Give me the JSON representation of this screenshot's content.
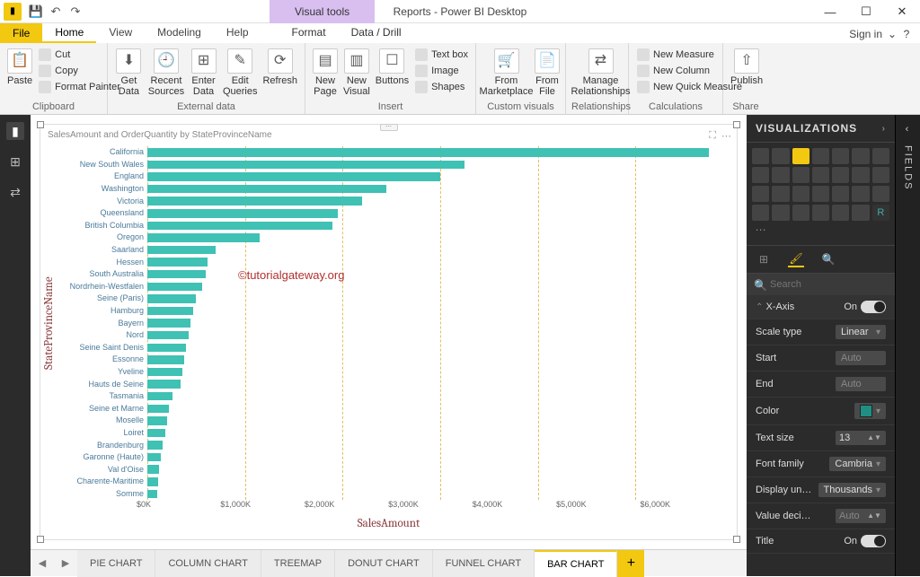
{
  "titlebar": {
    "app_title": "Reports - Power BI Desktop",
    "visual_tools": "Visual tools",
    "app_icon": "⬛"
  },
  "window_controls": {
    "min": "—",
    "max": "☐",
    "close": "✕"
  },
  "menu": {
    "file": "File",
    "home": "Home",
    "view": "View",
    "modeling": "Modeling",
    "help": "Help",
    "format": "Format",
    "datadrill": "Data / Drill",
    "signin": "Sign in"
  },
  "ribbon": {
    "clipboard": {
      "label": "Clipboard",
      "paste": "Paste",
      "cut": "Cut",
      "copy": "Copy",
      "fp": "Format Painter"
    },
    "external": {
      "label": "External data",
      "getdata": "Get Data",
      "recent": "Recent Sources",
      "enter": "Enter Data",
      "edit": "Edit Queries",
      "refresh": "Refresh"
    },
    "insert": {
      "label": "Insert",
      "newpage": "New Page",
      "newvisual": "New Visual",
      "buttons": "Buttons",
      "textbox": "Text box",
      "image": "Image",
      "shapes": "Shapes"
    },
    "custom": {
      "label": "Custom visuals",
      "market": "From Marketplace",
      "file": "From File"
    },
    "rel": {
      "label": "Relationships",
      "manage": "Manage Relationships"
    },
    "calc": {
      "label": "Calculations",
      "nm": "New Measure",
      "nc": "New Column",
      "nqm": "New Quick Measure"
    },
    "share": {
      "label": "Share",
      "publish": "Publish"
    }
  },
  "tabs": {
    "items": [
      "PIE CHART",
      "COLUMN CHART",
      "TREEMAP",
      "DONUT CHART",
      "FUNNEL CHART",
      "BAR CHART"
    ],
    "nav_prev": "◀",
    "nav_next": "▶",
    "add": "+"
  },
  "visual": {
    "title": "SalesAmount and OrderQuantity by StateProvinceName",
    "ylabel": "StateProvinceName",
    "xlabel": "SalesAmount",
    "watermark": "©tutorialgateway.org",
    "xticks": [
      "$0K",
      "$1,000K",
      "$2,000K",
      "$3,000K",
      "$4,000K",
      "$5,000K",
      "$6,000K"
    ]
  },
  "chart_data": {
    "type": "bar",
    "categories": [
      "California",
      "New South Wales",
      "England",
      "Washington",
      "Victoria",
      "Queensland",
      "British Columbia",
      "Oregon",
      "Saarland",
      "Hessen",
      "South Australia",
      "Nordrhein-Westfalen",
      "Seine (Paris)",
      "Hamburg",
      "Bayern",
      "Nord",
      "Seine Saint Denis",
      "Essonne",
      "Yveline",
      "Hauts de Seine",
      "Tasmania",
      "Seine et Marne",
      "Moselle",
      "Loiret",
      "Brandenburg",
      "Garonne (Haute)",
      "Val d'Oise",
      "Charente-Maritime",
      "Somme"
    ],
    "values": [
      5750,
      3250,
      3000,
      2450,
      2200,
      1950,
      1900,
      1150,
      700,
      620,
      600,
      560,
      500,
      470,
      440,
      420,
      400,
      380,
      360,
      340,
      260,
      220,
      200,
      180,
      160,
      140,
      120,
      110,
      100
    ],
    "xlabel": "SalesAmount",
    "ylabel": "StateProvinceName",
    "xlim": [
      0,
      6000
    ],
    "x_format": "Thousands, prefix $, suffix K",
    "title": "SalesAmount and OrderQuantity by StateProvinceName"
  },
  "right": {
    "header": "VISUALIZATIONS",
    "fields": "FIELDS",
    "search": "Search",
    "xaxis": {
      "title": "X-Axis",
      "state": "On",
      "scale_label": "Scale type",
      "scale": "Linear",
      "start_label": "Start",
      "start": "Auto",
      "end_label": "End",
      "end": "Auto",
      "color_label": "Color",
      "size_label": "Text size",
      "size": "13",
      "font_label": "Font family",
      "font": "Cambria",
      "disp_label": "Display un…",
      "disp": "Thousands",
      "dec_label": "Value deci…",
      "dec": "Auto",
      "title_label": "Title",
      "title_state": "On"
    }
  }
}
